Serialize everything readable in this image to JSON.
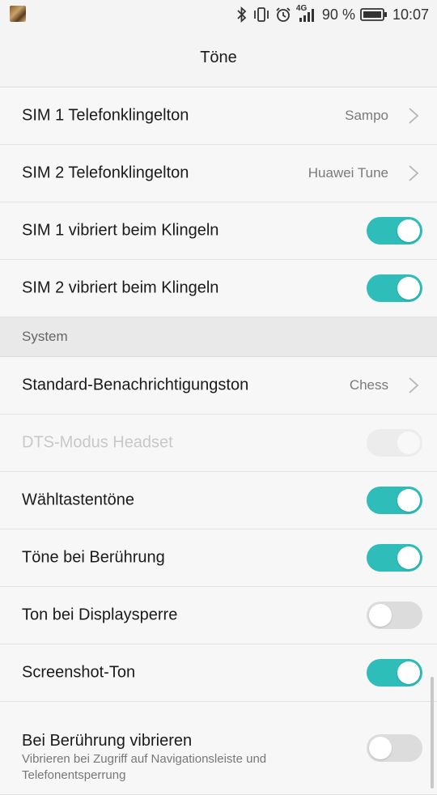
{
  "status_bar": {
    "network": "4G",
    "battery_percent": "90 %",
    "time": "10:07"
  },
  "header": {
    "title": "Töne"
  },
  "section_system": {
    "label": "System"
  },
  "rows": [
    {
      "label": "SIM 1 Telefonklingelton",
      "value": "Sampo"
    },
    {
      "label": "SIM 2 Telefonklingelton",
      "value": "Huawei Tune"
    },
    {
      "label": "SIM 1 vibriert beim Klingeln",
      "toggle": true
    },
    {
      "label": "SIM 2 vibriert beim Klingeln",
      "toggle": true
    },
    {
      "label": "Standard-Benachrichtigungston",
      "value": "Chess"
    },
    {
      "label": "DTS-Modus Headset",
      "toggle": true,
      "disabled": true
    },
    {
      "label": "Wähltastentöne",
      "toggle": true
    },
    {
      "label": "Töne bei Berührung",
      "toggle": true
    },
    {
      "label": "Ton bei Displaysperre",
      "toggle": false
    },
    {
      "label": "Screenshot-Ton",
      "toggle": true
    },
    {
      "label": "Bei Berührung vibrieren",
      "sublabel": "Vibrieren bei Zugriff auf Navigationsleiste und Telefonentsperrung",
      "toggle": false
    }
  ],
  "colors": {
    "accent": "#2ebdb8",
    "toggle_off": "#dcdcdc"
  }
}
